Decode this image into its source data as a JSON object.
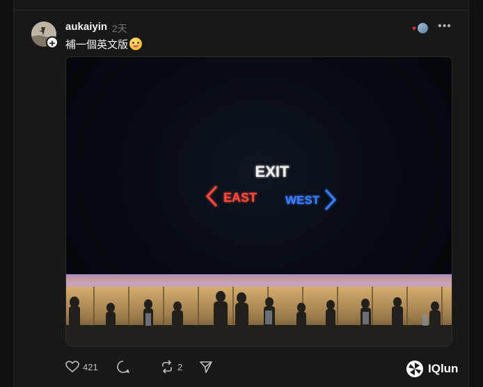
{
  "post": {
    "username": "aukaiyin",
    "timestamp": "2天",
    "text": "補一個英文版",
    "emoji": "face-with-tongue-emoji",
    "more_label": "•••"
  },
  "follow_badge": "+",
  "media": {
    "sign_title": "EXIT",
    "left_label": "EAST",
    "right_label": "WEST",
    "colors": {
      "exit": "#f2f2f2",
      "east": "#ff4a3d",
      "west": "#3c7dff"
    }
  },
  "actions": {
    "like": {
      "icon": "heart-icon",
      "count": "421"
    },
    "comment": {
      "icon": "comment-icon",
      "count": ""
    },
    "repost": {
      "icon": "repost-icon",
      "count": "2"
    },
    "share": {
      "icon": "send-icon",
      "count": ""
    }
  },
  "watermark": {
    "text": "IQlun",
    "icon": "iqlun-logo-icon"
  },
  "liked_by": {
    "icon": "heart-icon"
  }
}
